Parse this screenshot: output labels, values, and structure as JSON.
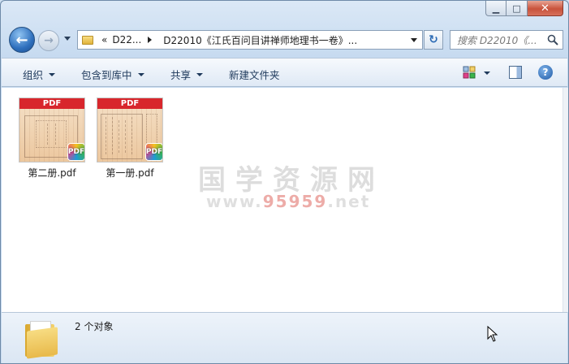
{
  "window": {
    "caption_buttons": {
      "minimize_glyph": "▁",
      "maximize_glyph": "□",
      "close_glyph": "✕"
    }
  },
  "nav": {
    "back_glyph": "←",
    "forward_glyph": "→",
    "address": {
      "chevron": "«",
      "crumb_parent": "D22...",
      "crumb_current": "D22010《江氏百问目讲禅师地理书一卷》..."
    },
    "refresh_glyph": "↻",
    "search_placeholder": "搜索 D22010《..."
  },
  "toolbar": {
    "organize": "组织",
    "include_in_library": "包含到库中",
    "share": "共享",
    "new_folder": "新建文件夹",
    "help_glyph": "?"
  },
  "files": [
    {
      "name": "第二册.pdf",
      "banner": "PDF",
      "badge": "PDF"
    },
    {
      "name": "第一册.pdf",
      "banner": "PDF",
      "badge": "PDF"
    }
  ],
  "watermark": {
    "title": "国学资源网",
    "url_prefix": "www.",
    "url_highlight": "95959",
    "url_suffix": ".net"
  },
  "details": {
    "object_count": "2 个对象"
  },
  "colors": {
    "pdf_red": "#d8262c",
    "accent_blue": "#2e6fbd"
  }
}
